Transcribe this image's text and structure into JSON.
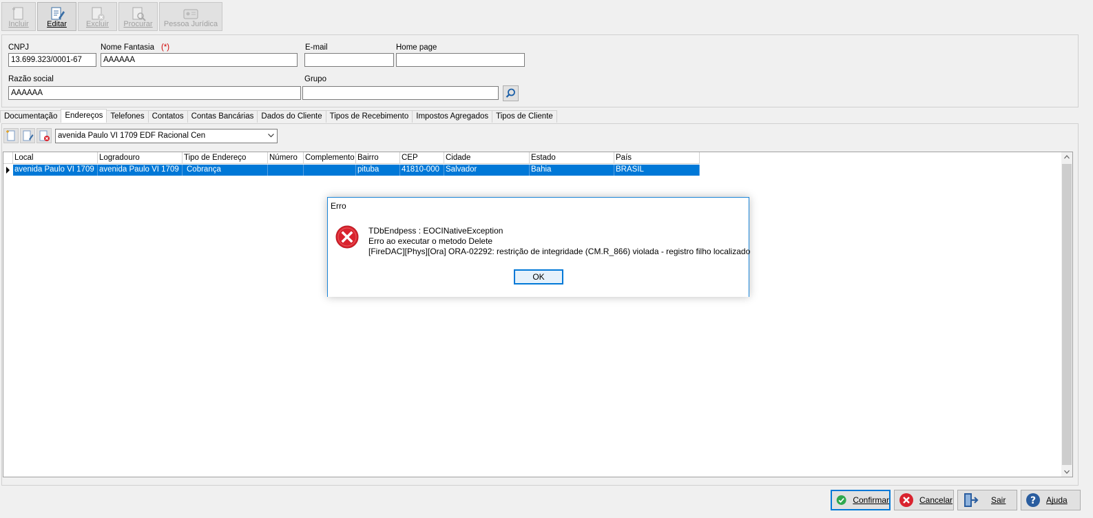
{
  "toolbar": {
    "incluir": "Incluir",
    "editar": "Editar",
    "excluir": "Excluir",
    "procurar": "Procurar",
    "pessoa_juridica": "Pessoa Jurídica"
  },
  "form": {
    "cnpj_label": "CNPJ",
    "cnpj_value": "13.699.323/0001-67",
    "nome_fantasia_label": "Nome Fantasia",
    "required_mark": "(*)",
    "nome_fantasia_value": "AAAAAA",
    "email_label": "E-mail",
    "email_value": "",
    "homepage_label": "Home page",
    "homepage_value": "",
    "razao_social_label": "Razão social",
    "razao_social_value": "AAAAAA",
    "grupo_label": "Grupo",
    "grupo_value": ""
  },
  "tabs": [
    {
      "label": "Documentação"
    },
    {
      "label": "Endereços",
      "active": true
    },
    {
      "label": "Telefones"
    },
    {
      "label": "Contatos"
    },
    {
      "label": "Contas Bancárias"
    },
    {
      "label": "Dados do Cliente"
    },
    {
      "label": "Tipos de Recebimento"
    },
    {
      "label": "Impostos Agregados"
    },
    {
      "label": "Tipos de Cliente"
    }
  ],
  "address_select": {
    "value": "avenida Paulo VI  1709  EDF Racional Cen"
  },
  "grid": {
    "columns": [
      "Local",
      "Logradouro",
      "Tipo de Endereço",
      "Número",
      "Complemento",
      "Bairro",
      "CEP",
      "Cidade",
      "Estado",
      "País"
    ],
    "rows": [
      [
        "avenida Paulo VI  1709",
        "avenida Paulo VI  1709",
        "Cobrança",
        "",
        "",
        "pituba",
        "41810-000",
        "Salvador",
        "Bahia",
        "BRASIL"
      ]
    ]
  },
  "dialog": {
    "title": "Erro",
    "line1": "TDbEndpess : EOCINativeException",
    "line2": "Erro ao executar o metodo Delete",
    "line3": "[FireDAC][Phys][Ora] ORA-02292: restrição de integridade (CM.R_866) violada - registro filho localizado",
    "ok": "OK"
  },
  "bottom": {
    "confirmar": "Confirmar",
    "cancelar": "Cancelar",
    "sair": "Sair",
    "ajuda": "Ajuda"
  },
  "colors": {
    "selection": "#0078d7",
    "dialog_border": "#1883d7",
    "error_red": "#d9232e",
    "confirm_green": "#2fa84f"
  }
}
